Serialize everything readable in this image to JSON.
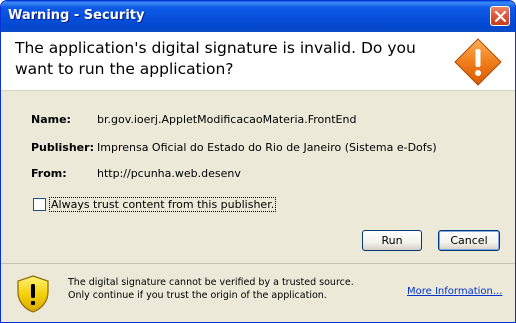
{
  "window": {
    "title": "Warning - Security"
  },
  "header": {
    "headline": "The application's digital signature is invalid.  Do you want to run the application?"
  },
  "details": [
    {
      "label": "Name:",
      "value": "br.gov.ioerj.AppletModificacaoMateria.FrontEnd"
    },
    {
      "label": "Publisher:",
      "value": "Imprensa Oficial do Estado do Rio de Janeiro (Sistema e-Dofs)"
    },
    {
      "label": "From:",
      "value": "http://pcunha.web.desenv"
    }
  ],
  "trust": {
    "label": "Always trust content from this publisher.",
    "checked": false
  },
  "buttons": {
    "run": "Run",
    "cancel": "Cancel"
  },
  "footer": {
    "message": "The digital signature cannot be verified by a trusted source.  Only continue if you trust the origin of the application.",
    "more_info": "More Information..."
  },
  "icons": {
    "header_icon": "warning-diamond-icon",
    "footer_icon": "shield-warning-icon",
    "close_icon": "close-icon"
  },
  "colors": {
    "titlebar": "#0851dd",
    "close_button": "#e0583a",
    "warning_orange": "#f07d1a",
    "shield_yellow": "#f5d20a",
    "link": "#0033cc"
  }
}
